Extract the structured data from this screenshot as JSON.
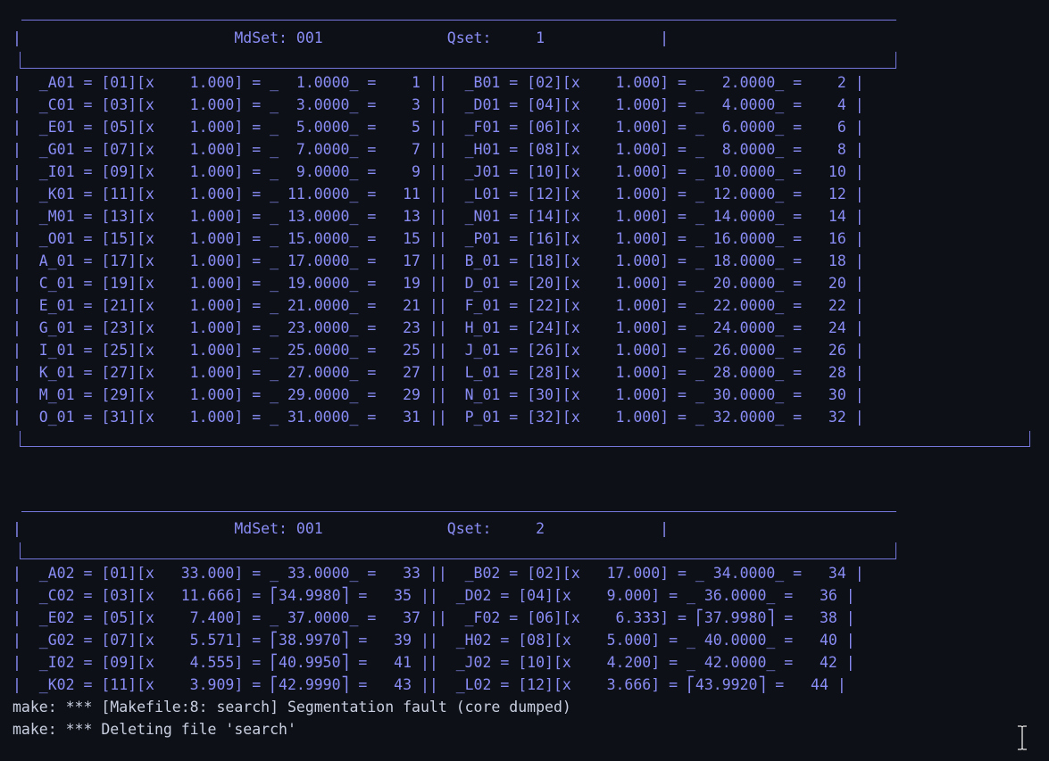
{
  "block1": {
    "header": "|                        MdSet: 001              Qset:     1             |",
    "rows": [
      "|  _A01 = [01][x    1.000] = _  1.0000_ =    1 ||  _B01 = [02][x    1.000] = _  2.0000_ =    2 |",
      "|  _C01 = [03][x    1.000] = _  3.0000_ =    3 ||  _D01 = [04][x    1.000] = _  4.0000_ =    4 |",
      "|  _E01 = [05][x    1.000] = _  5.0000_ =    5 ||  _F01 = [06][x    1.000] = _  6.0000_ =    6 |",
      "|  _G01 = [07][x    1.000] = _  7.0000_ =    7 ||  _H01 = [08][x    1.000] = _  8.0000_ =    8 |",
      "|  _I01 = [09][x    1.000] = _  9.0000_ =    9 ||  _J01 = [10][x    1.000] = _ 10.0000_ =   10 |",
      "|  _K01 = [11][x    1.000] = _ 11.0000_ =   11 ||  _L01 = [12][x    1.000] = _ 12.0000_ =   12 |",
      "|  _M01 = [13][x    1.000] = _ 13.0000_ =   13 ||  _N01 = [14][x    1.000] = _ 14.0000_ =   14 |",
      "|  _O01 = [15][x    1.000] = _ 15.0000_ =   15 ||  _P01 = [16][x    1.000] = _ 16.0000_ =   16 |",
      "|  A_01 = [17][x    1.000] = _ 17.0000_ =   17 ||  B_01 = [18][x    1.000] = _ 18.0000_ =   18 |",
      "|  C_01 = [19][x    1.000] = _ 19.0000_ =   19 ||  D_01 = [20][x    1.000] = _ 20.0000_ =   20 |",
      "|  E_01 = [21][x    1.000] = _ 21.0000_ =   21 ||  F_01 = [22][x    1.000] = _ 22.0000_ =   22 |",
      "|  G_01 = [23][x    1.000] = _ 23.0000_ =   23 ||  H_01 = [24][x    1.000] = _ 24.0000_ =   24 |",
      "|  I_01 = [25][x    1.000] = _ 25.0000_ =   25 ||  J_01 = [26][x    1.000] = _ 26.0000_ =   26 |",
      "|  K_01 = [27][x    1.000] = _ 27.0000_ =   27 ||  L_01 = [28][x    1.000] = _ 28.0000_ =   28 |",
      "|  M_01 = [29][x    1.000] = _ 29.0000_ =   29 ||  N_01 = [30][x    1.000] = _ 30.0000_ =   30 |",
      "|  O_01 = [31][x    1.000] = _ 31.0000_ =   31 ||  P_01 = [32][x    1.000] = _ 32.0000_ =   32 |"
    ]
  },
  "block2": {
    "header": "|                        MdSet: 001              Qset:     2             |",
    "rows": [
      "|  _A02 = [01][x   33.000] = _ 33.0000_ =   33 ||  _B02 = [02][x   17.000] = _ 34.0000_ =   34 |",
      "|  _C02 = [03][x   11.666] = ⎡34.9980⎤ =   35 ||  _D02 = [04][x    9.000] = _ 36.0000_ =   36 |",
      "|  _E02 = [05][x    7.400] = _ 37.0000_ =   37 ||  _F02 = [06][x    6.333] = ⎡37.9980⎤ =   38 |",
      "|  _G02 = [07][x    5.571] = ⎡38.9970⎤ =   39 ||  _H02 = [08][x    5.000] = _ 40.0000_ =   40 |",
      "|  _I02 = [09][x    4.555] = ⎡40.9950⎤ =   41 ||  _J02 = [10][x    4.200] = _ 42.0000_ =   42 |",
      "|  _K02 = [11][x    3.909] = ⎡42.9990⎤ =   43 ||  _L02 = [12][x    3.666] = ⎡43.9920⎤ =   44 |"
    ]
  },
  "errors": [
    "make: *** [Makefile:8: search] Segmentation fault (core dumped)",
    "make: *** Deleting file 'search'"
  ],
  "icons": {
    "cursor": "text-cursor-icon"
  }
}
